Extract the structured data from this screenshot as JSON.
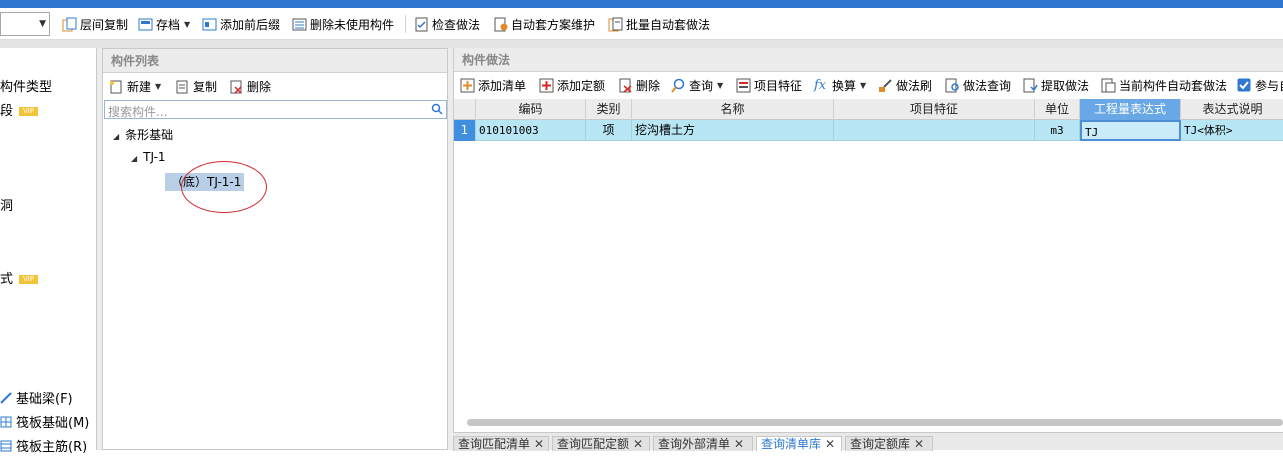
{
  "toolbar": {
    "items": [
      {
        "label": "层间复制",
        "icon": "copy-floors-icon"
      },
      {
        "label": "存档",
        "icon": "archive-icon",
        "dropdown": true
      },
      {
        "label": "添加前后缀",
        "icon": "prefix-suffix-icon"
      },
      {
        "label": "删除未使用构件",
        "icon": "delete-unused-icon"
      },
      {
        "label": "检查做法",
        "icon": "check-method-icon"
      },
      {
        "label": "自动套方案维护",
        "icon": "auto-plan-icon"
      },
      {
        "label": "批量自动套做法",
        "icon": "batch-auto-icon"
      }
    ]
  },
  "left_panel": {
    "items": [
      {
        "label": "构件类型"
      },
      {
        "label": "段",
        "vip": "VIP"
      },
      {
        "label": "洞"
      },
      {
        "label": "式",
        "vip": "VIP"
      },
      {
        "label": "基础梁(F)"
      },
      {
        "label": "筏板基础(M)"
      },
      {
        "label": "筏板主筋(R)"
      }
    ]
  },
  "component_list": {
    "title": "构件列表",
    "tools": {
      "new": "新建",
      "copy": "复制",
      "delete": "删除"
    },
    "search_placeholder": "搜索构件...",
    "tree": {
      "root": "条形基础",
      "child": "TJ-1",
      "selected": "（底）TJ-1-1"
    }
  },
  "component_method": {
    "title": "构件做法",
    "tools": [
      "添加清单",
      "添加定额",
      "删除",
      "查询",
      "项目特征",
      "换算",
      "做法刷",
      "做法查询",
      "提取做法",
      "当前构件自动套做法",
      "参与自"
    ],
    "columns": [
      "编码",
      "类别",
      "名称",
      "项目特征",
      "单位",
      "工程量表达式",
      "表达式说明"
    ],
    "rows": [
      {
        "num": "1",
        "code": "010101003",
        "category": "项",
        "name": "挖沟槽土方",
        "feature": "",
        "unit": "m3",
        "expr": "TJ",
        "expr_desc": "TJ<体积>"
      }
    ]
  },
  "bottom_tabs": [
    {
      "label": "查询匹配清单",
      "active": false
    },
    {
      "label": "查询匹配定额",
      "active": false
    },
    {
      "label": "查询外部清单",
      "active": false
    },
    {
      "label": "查询清单库",
      "active": true
    },
    {
      "label": "查询定额库",
      "active": false
    }
  ],
  "colors": {
    "accent": "#2e78d2",
    "row_highlight": "#b9e6f5",
    "selection_circle": "#d62a2a",
    "vip": "#f3c43a"
  }
}
